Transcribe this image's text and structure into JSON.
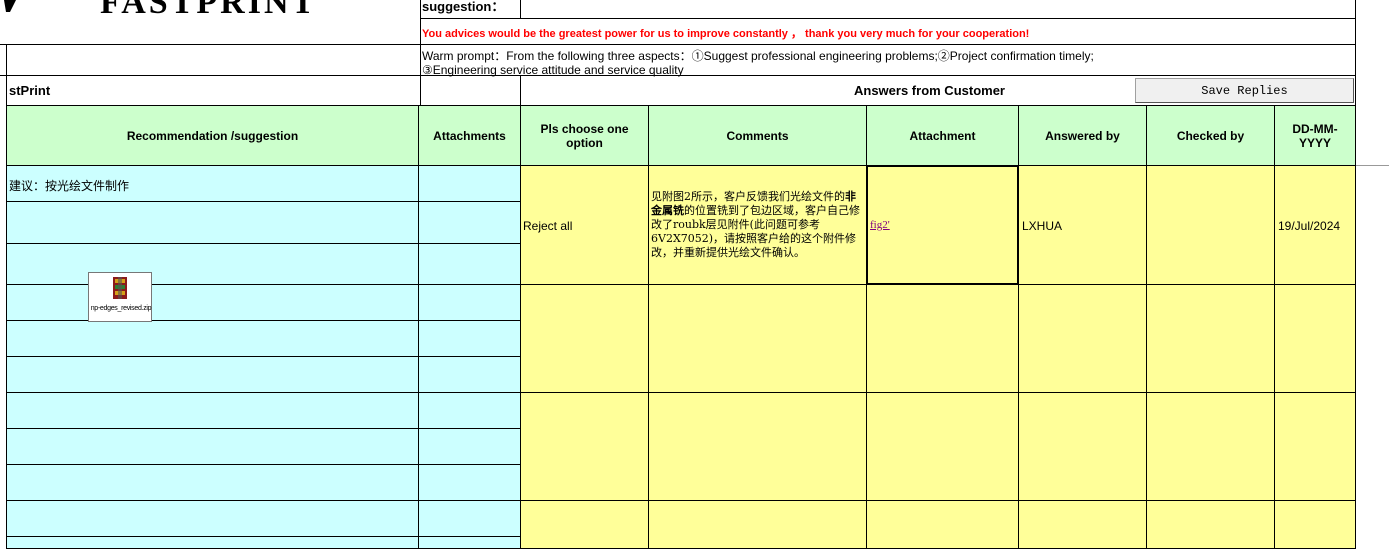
{
  "logo": {
    "text": "FASTPRINT"
  },
  "suggestion_label": "suggestion：",
  "advice_text": "You advices would be the greatest power for us to improve constantly ，  thank you very much for your cooperation!",
  "warm_prompt": {
    "line1": "Warm prompt：From the following three aspects：①Suggest professional engineering problems;②Project confirmation timely;",
    "line2": "③Engineering service attitude and service quality"
  },
  "section": {
    "left_title": "stPrint",
    "right_title": "Answers from Customer",
    "save_button": "Save Replies"
  },
  "columns": {
    "recommendation": "Recommendation /suggestion",
    "attachments": "Attachments",
    "choose_option": "Pls choose one option",
    "comments": "Comments",
    "attachment": "Attachment",
    "answered_by": "Answered by",
    "checked_by": "Checked by",
    "date": "DD-MM-YYYY"
  },
  "rows": [
    {
      "recommendation": "建议：按光绘文件制作",
      "attachment_file": "np-edges_revised.zip",
      "option": "Reject all",
      "comment_pre": "见附图2所示，客户反馈我们光绘文件的",
      "comment_bold": "非金属铣",
      "comment_post": "的位置铣到了包边区域，客户自己修改了roubk层见附件(此问题可参考6V2X7052)，请按照客户给的这个附件修改，并重新提供光绘文件确认。",
      "attachment_link": "fig2'",
      "answered_by": "LXHUA",
      "checked_by": "",
      "date": "19/Jul/2024"
    }
  ],
  "colors": {
    "cyan": "#ccffff",
    "yellow": "#ffff99",
    "green": "#ccffcc",
    "red": "#ff0000",
    "link": "#800080"
  }
}
